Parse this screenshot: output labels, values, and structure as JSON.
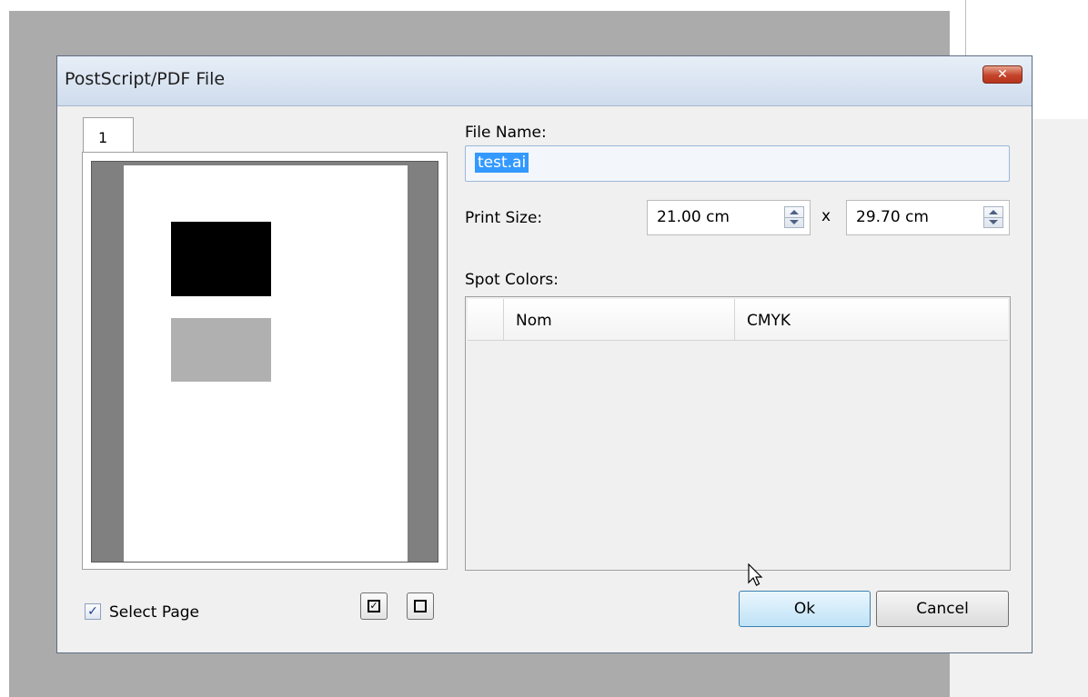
{
  "dialog": {
    "title": "PostScript/PDF File",
    "close_icon": "close-icon",
    "close_glyph": "✕"
  },
  "preview": {
    "tab_label": "1",
    "select_page_label": "Select Page",
    "select_page_checked": true,
    "check_glyph": "✓",
    "select_all_icon": "checked-box-icon",
    "select_all_glyph": "✓",
    "deselect_all_icon": "empty-box-icon"
  },
  "form": {
    "file_name_label": "File Name:",
    "file_name_value": "test.ai",
    "print_size_label": "Print Size:",
    "width_value": "21.00 cm",
    "times_symbol": "x",
    "height_value": "29.70 cm",
    "spot_colors_label": "Spot Colors:",
    "columns": [
      "Nom",
      "CMYK"
    ]
  },
  "buttons": {
    "ok": "Ok",
    "cancel": "Cancel"
  },
  "colors": {
    "selection": "#3399ff",
    "close_button": "#c4442b",
    "titlebar": "#dbe5f1"
  }
}
